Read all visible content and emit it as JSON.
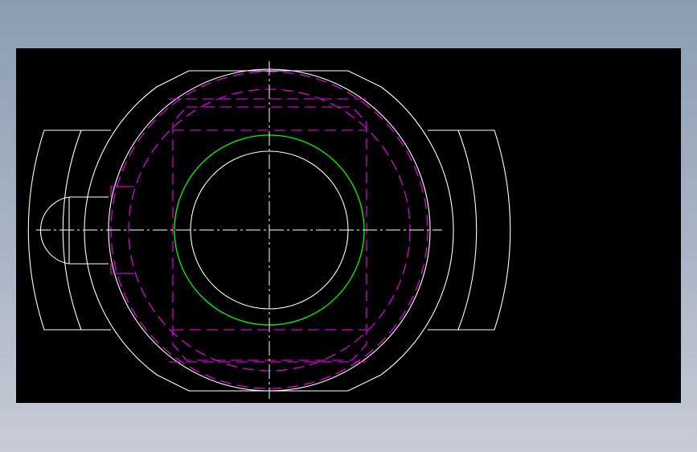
{
  "drawing": {
    "background_color": "#000000",
    "colors": {
      "outline": "#ffffff",
      "hidden": "#ff00ff",
      "bore_highlight": "#00ff00",
      "centerline": "#ffffff"
    },
    "line_styles": {
      "hidden": "dashed",
      "centerline": "dash-dot"
    }
  }
}
